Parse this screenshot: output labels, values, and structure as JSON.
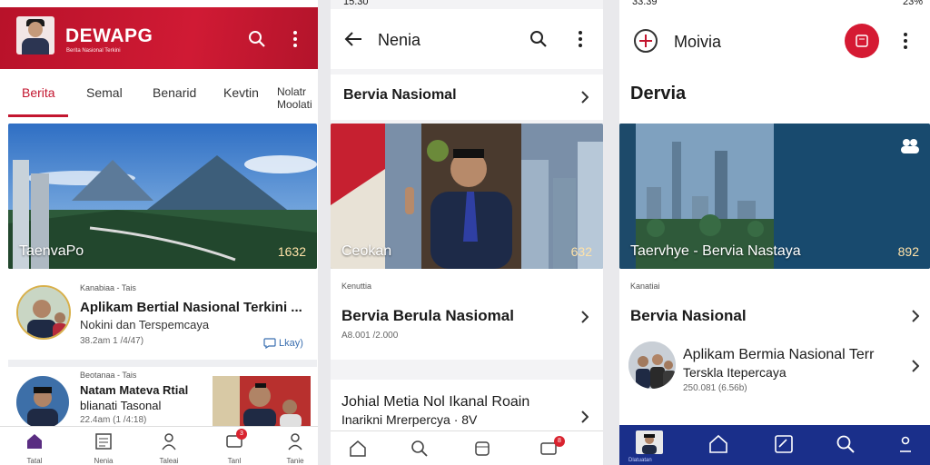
{
  "screen1": {
    "status_time": "",
    "app_title": "DEWAPG",
    "app_subtitle": "Berita Nasional Terkini",
    "tabs": [
      "Berita",
      "Semal",
      "Benarid",
      "Kevtin",
      "Nolatr Moolati"
    ],
    "hero_caption": "TaenvaPo",
    "hero_number": "1632",
    "item1": {
      "meta": "Kanabiaa - Tais",
      "title": "Aplikam Bertial Nasional Terkini ...",
      "subtitle": "Nokini dan Terspemcaya",
      "time": "38.2am 1 /4/47)",
      "comment_count": "Lkay)"
    },
    "item2": {
      "meta": "Beotanaa - Tais",
      "title": "Natam Mateva Rtial",
      "subtitle": "blianati Tasonal",
      "time": "22.4am (1 /4:18)"
    },
    "nav": [
      {
        "label": "Tatal",
        "icon": "home-icon"
      },
      {
        "label": "Nenia",
        "icon": "news-icon"
      },
      {
        "label": "Taleai",
        "icon": "profile-icon"
      },
      {
        "label": "Tanl",
        "icon": "notification-icon",
        "badge": "3"
      },
      {
        "label": "Tanie",
        "icon": "account-icon"
      }
    ]
  },
  "screen2": {
    "status_time": "15.30",
    "app_title": "Nenia",
    "section_title": "Bervia Nasiomal",
    "hero_caption": "Ceokan",
    "hero_number": "632",
    "card1": {
      "meta": "Kenuttia",
      "title": "Bervia Berula Nasiomal",
      "time": "A8.001 /2.000"
    },
    "card2": {
      "title": "Johial Metia Nol Ikanal Roain",
      "subtitle": "Inarikni Mrerpercya · 8V"
    },
    "nav_badge": "8"
  },
  "screen3": {
    "status_time": "33.39",
    "battery": "23%",
    "app_title": "Moivia",
    "section_title": "Dervia",
    "hero_caption": "Taervhye - Bervia Nastaya",
    "hero_number": "892",
    "card1": {
      "meta": "Kanatiai",
      "title": "Bervia Nasional"
    },
    "item1": {
      "title": "Aplikam Bermia Nasional Terr",
      "subtitle": "Terskla Itepercaya",
      "time": "250.081 (6.56b)"
    },
    "nav_label": "Dlatuatan"
  },
  "colors": {
    "brand_red": "#c3162f",
    "nav_blue": "#1a2f8a"
  }
}
